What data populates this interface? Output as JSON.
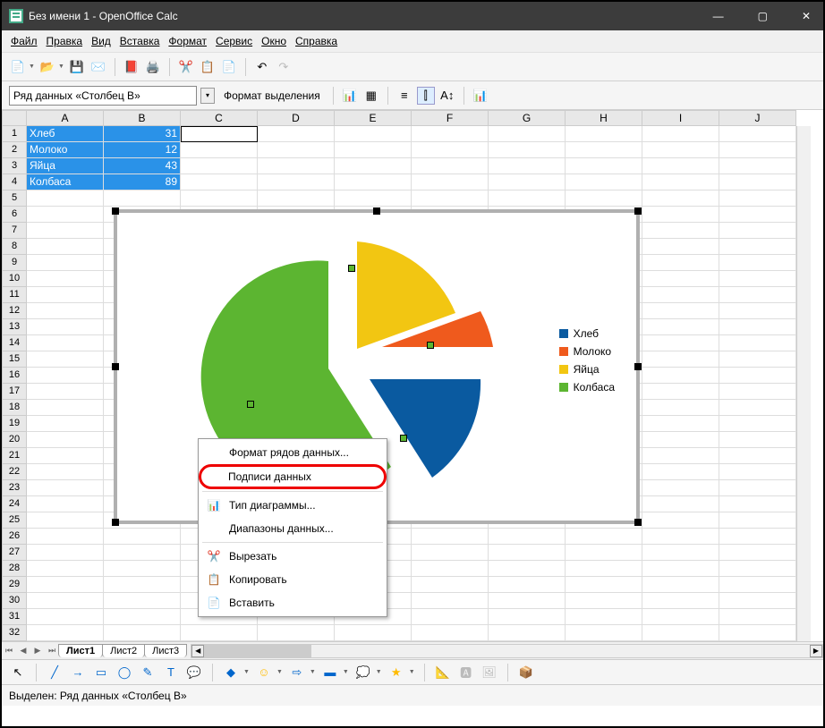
{
  "window": {
    "title": "Без имени 1 - OpenOffice Calc"
  },
  "menubar": {
    "items": [
      "Файл",
      "Правка",
      "Вид",
      "Вставка",
      "Формат",
      "Сервис",
      "Окно",
      "Справка"
    ]
  },
  "namebox": {
    "value": "Ряд данных «Столбец B»"
  },
  "format_selection": "Формат выделения",
  "columns": [
    "A",
    "B",
    "C",
    "D",
    "E",
    "F",
    "G",
    "H",
    "I",
    "J"
  ],
  "rows": [
    "1",
    "2",
    "3",
    "4",
    "5",
    "6",
    "7",
    "8",
    "9",
    "10",
    "11",
    "12",
    "13",
    "14",
    "15",
    "16",
    "17",
    "18",
    "19",
    "20",
    "21",
    "22",
    "23",
    "24",
    "25",
    "26",
    "27",
    "28",
    "29",
    "30",
    "31",
    "32"
  ],
  "cells": {
    "a1": "Хлеб",
    "b1": "31",
    "a2": "Молоко",
    "b2": "12",
    "a3": "Яйца",
    "b3": "43",
    "a4": "Колбаса",
    "b4": "89"
  },
  "legend": {
    "items": [
      {
        "label": "Хлеб",
        "color": "#0a5aa0"
      },
      {
        "label": "Молоко",
        "color": "#ef5a1d"
      },
      {
        "label": "Яйца",
        "color": "#f2c612"
      },
      {
        "label": "Колбаса",
        "color": "#5cb531"
      }
    ]
  },
  "context_menu": {
    "format_series": "Формат рядов данных...",
    "data_labels": "Подписи данных",
    "chart_type": "Тип диаграммы...",
    "data_ranges": "Диапазоны данных...",
    "cut": "Вырезать",
    "copy": "Копировать",
    "paste": "Вставить"
  },
  "sheets": [
    "Лист1",
    "Лист2",
    "Лист3"
  ],
  "status": "Выделен: Ряд данных «Столбец B»",
  "chart_data": {
    "type": "pie",
    "categories": [
      "Хлеб",
      "Молоко",
      "Яйца",
      "Колбаса"
    ],
    "values": [
      31,
      12,
      43,
      89
    ],
    "colors": [
      "#0a5aa0",
      "#ef5a1d",
      "#f2c612",
      "#5cb531"
    ],
    "exploded": true,
    "legend_position": "right"
  }
}
